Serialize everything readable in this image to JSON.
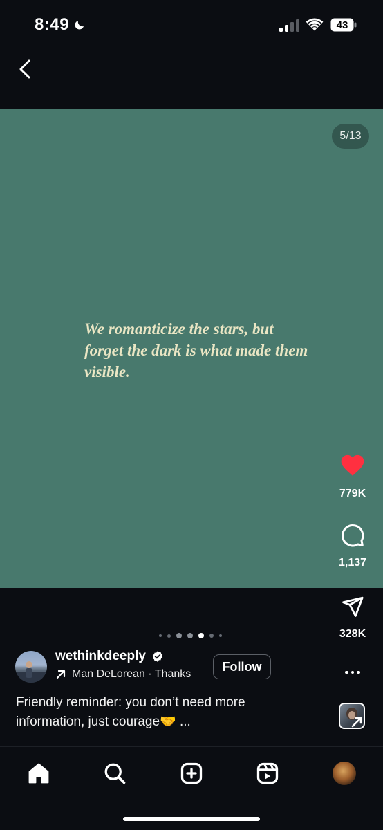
{
  "status_bar": {
    "time": "8:49",
    "battery": "43"
  },
  "post": {
    "slide_counter": "5/13",
    "quote": "We romanticize the stars, but forget the dark is what made them visible.",
    "background_color": "#48796d",
    "quote_color": "#eae6c4"
  },
  "actions": {
    "likes": "779K",
    "comments": "1,137",
    "shares": "328K",
    "like_color": "#ff3040"
  },
  "pager": {
    "total_visible_dots": 7,
    "active_index": 4
  },
  "author": {
    "username": "wethinkdeeply",
    "verified": true,
    "music": "Man DeLorean · Thanks",
    "follow_label": "Follow"
  },
  "caption": {
    "text": "Friendly reminder: you don’t need more information, just courage🤝 ..."
  },
  "nav": {
    "items": [
      "home-icon",
      "search-icon",
      "create-icon",
      "reels-icon",
      "profile-avatar"
    ]
  }
}
